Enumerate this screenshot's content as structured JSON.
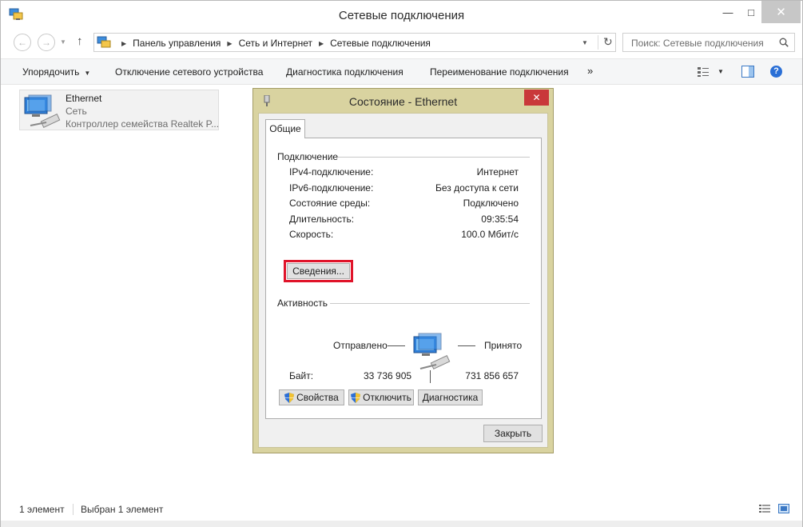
{
  "window": {
    "title": "Сетевые подключения",
    "controls": {
      "minimize": "—",
      "maximize": "□",
      "close": "✕"
    }
  },
  "address": {
    "breadcrumbs": [
      "Панель управления",
      "Сеть и Интернет",
      "Сетевые подключения"
    ],
    "search_placeholder": "Поиск: Сетевые подключения"
  },
  "commands": {
    "organize": "Упорядочить",
    "disable_device": "Отключение сетевого устройства",
    "diagnose": "Диагностика подключения",
    "rename": "Переименование подключения",
    "more": "»"
  },
  "connection": {
    "name": "Ethernet",
    "type": "Сеть",
    "adapter": "Контроллер семейства Realtek P..."
  },
  "statusbar": {
    "count": "1 элемент",
    "selected": "Выбран 1 элемент"
  },
  "dialog": {
    "title": "Состояние - Ethernet",
    "close": "✕",
    "tab": "Общие",
    "connection_group": "Подключение",
    "rows": [
      {
        "label": "IPv4-подключение:",
        "value": "Интернет"
      },
      {
        "label": "IPv6-подключение:",
        "value": "Без доступа к сети"
      },
      {
        "label": "Состояние среды:",
        "value": "Подключено"
      },
      {
        "label": "Длительность:",
        "value": "09:35:54"
      },
      {
        "label": "Скорость:",
        "value": "100.0 Мбит/с"
      }
    ],
    "details_button": "Сведения...",
    "activity_group": "Активность",
    "sent_label": "Отправлено",
    "received_label": "Принято",
    "bytes_label": "Байт:",
    "bytes_sent": "33 736 905",
    "bytes_received": "731 856 657",
    "properties_button": "Свойства",
    "disable_button": "Отключить",
    "diagnose_button": "Диагностика",
    "close_button": "Закрыть"
  },
  "colors": {
    "dialog_frame": "#d9d3a0",
    "dialog_close": "#c9383a",
    "highlight": "#e0142a",
    "command_bar": "#f5f6f7"
  }
}
